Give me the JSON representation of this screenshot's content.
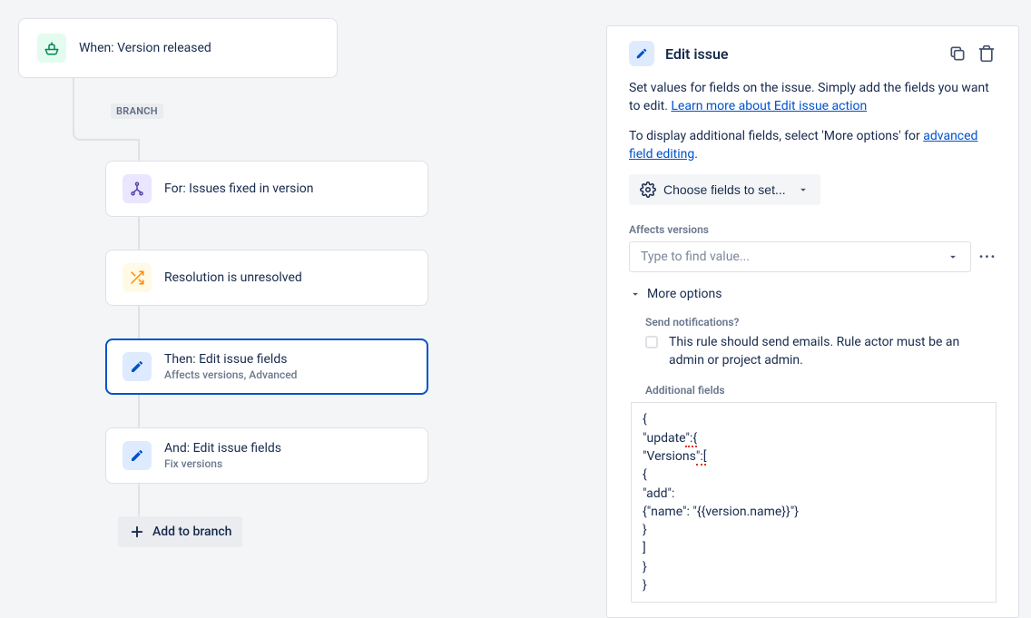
{
  "trigger": {
    "label": "When: Version released"
  },
  "branch": {
    "tag": "BRANCH",
    "nodes": [
      {
        "title": "For: Issues fixed in version",
        "sub": "",
        "icon": "network-icon",
        "iconClass": "icon-purple",
        "selected": false
      },
      {
        "title": "Resolution is unresolved",
        "sub": "",
        "icon": "shuffle-icon",
        "iconClass": "icon-yellow",
        "selected": false
      },
      {
        "title": "Then: Edit issue fields",
        "sub": "Affects versions, Advanced",
        "icon": "pencil-icon",
        "iconClass": "icon-blue",
        "selected": true
      },
      {
        "title": "And: Edit issue fields",
        "sub": "Fix versions",
        "icon": "pencil-icon",
        "iconClass": "icon-blue",
        "selected": false
      }
    ],
    "addButton": "Add to branch"
  },
  "panel": {
    "title": "Edit issue",
    "description1": "Set values for fields on the issue. Simply add the fields you want to edit. ",
    "learnMore": "Learn more about Edit issue action",
    "description2_pre": "To display additional fields, select 'More options' for ",
    "advancedLink": "advanced field editing",
    "description2_post": ".",
    "chooseFields": "Choose fields to set...",
    "affects": {
      "label": "Affects versions",
      "placeholder": "Type to find value..."
    },
    "moreOptions": "More options",
    "sendNotifications": {
      "label": "Send notifications?",
      "checkboxText": "This rule should send emails. Rule actor must be an admin or project admin."
    },
    "additionalFields": {
      "label": "Additional fields",
      "code_l1": "{",
      "code_l2a": "\"update",
      "code_l2b": "\":{",
      "code_l3a": "\"Versions",
      "code_l3b": "\":[",
      "code_l4": "{",
      "code_l5": "\"add\":",
      "code_l6": "{\"name\": \"{{version.name}}\"}",
      "code_l7": "}",
      "code_l8": "]",
      "code_l9": "}",
      "code_l10": "}"
    }
  }
}
